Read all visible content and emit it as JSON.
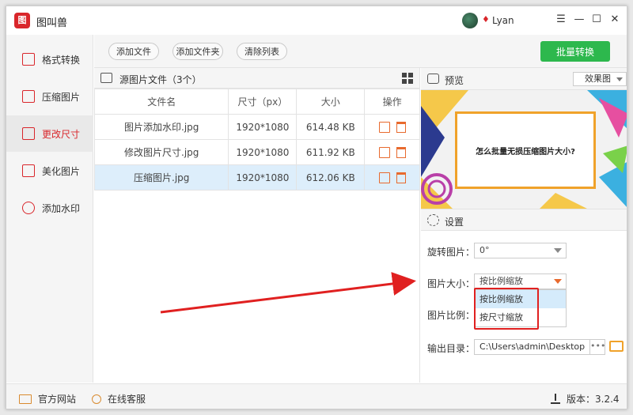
{
  "app": {
    "title": "图叫兽",
    "logo_text": "图",
    "username": "Lyan"
  },
  "window_controls": {
    "menu": "☰",
    "minimize": "—",
    "maximize": "☐",
    "close": "✕"
  },
  "sidebar": {
    "items": [
      {
        "label": "格式转换",
        "icon": "format-convert-icon",
        "active": false
      },
      {
        "label": "压缩图片",
        "icon": "compress-icon",
        "active": false
      },
      {
        "label": "更改尺寸",
        "icon": "resize-icon",
        "active": true
      },
      {
        "label": "美化图片",
        "icon": "beautify-icon",
        "active": false
      },
      {
        "label": "添加水印",
        "icon": "watermark-icon",
        "active": false
      }
    ]
  },
  "toolbar": {
    "add_file": "添加文件",
    "add_folder": "添加文件夹",
    "clear_list": "清除列表",
    "batch_convert": "批量转换"
  },
  "file_panel": {
    "title": "源图片文件（3个）",
    "columns": [
      "文件名",
      "尺寸（px）",
      "大小",
      "操作"
    ],
    "rows": [
      {
        "name": "图片添加水印.jpg",
        "size": "1920*1080",
        "filesize": "614.48 KB",
        "selected": false
      },
      {
        "name": "修改图片尺寸.jpg",
        "size": "1920*1080",
        "filesize": "611.92 KB",
        "selected": false
      },
      {
        "name": "压缩图片.jpg",
        "size": "1920*1080",
        "filesize": "612.06 KB",
        "selected": true
      }
    ]
  },
  "preview": {
    "label": "预览",
    "effect_select": "效果图",
    "image_text": "怎么批量无损压缩图片大小?"
  },
  "settings": {
    "label": "设置",
    "rotate_label": "旋转图片：",
    "rotate_value": "0°",
    "size_label": "图片大小：",
    "size_value": "按比例缩放",
    "size_options": [
      "按比例缩放",
      "按尺寸缩放"
    ],
    "ratio_label": "图片比例：",
    "output_label": "输出目录：",
    "output_path": "C:\\Users\\admin\\Desktop",
    "browse_dots": "•••"
  },
  "statusbar": {
    "website": "官方网站",
    "support": "在线客服",
    "version": "版本：3.2.4"
  },
  "colors": {
    "brand_red": "#d9262b",
    "green": "#2db84d",
    "orange": "#e86a2e",
    "selection_blue": "#ddeefb",
    "annotation_red": "#e02020"
  }
}
